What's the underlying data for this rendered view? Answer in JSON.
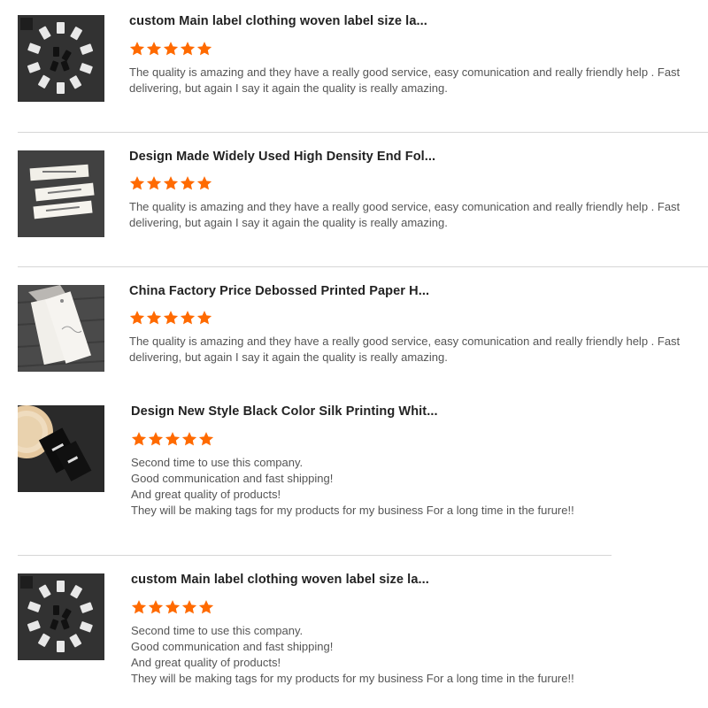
{
  "reviews": [
    {
      "title": "custom Main label clothing woven label size la...",
      "rating": 5,
      "text": "The quality is amazing and they have a really good service, easy comunication and really friendly help . Fast delivering, but again I say it again the quality is really amazing.",
      "thumbnail": "woven-labels-circle-photo"
    },
    {
      "title": "Design Made Widely Used High Density End Fol...",
      "rating": 5,
      "text": "The quality is amazing and they have a really good service, easy comunication and really friendly help . Fast delivering, but again I say it again the quality is really amazing.",
      "thumbnail": "folded-end-labels-photo"
    },
    {
      "title": "China Factory Price Debossed Printed Paper H...",
      "rating": 5,
      "text": "The quality is amazing and they have a really good service, easy comunication and really friendly help . Fast delivering, but again I say it again the quality is really amazing.",
      "thumbnail": "paper-hang-tags-photo"
    },
    {
      "title": "Design New Style Black Color Silk Printing Whit...",
      "rating": 5,
      "text": "Second time to use this company.\nGood communication and fast shipping!\nAnd great quality of products!\nThey will be making tags for my products for my business For a long time in the furure!!",
      "thumbnail": "black-printed-labels-photo"
    },
    {
      "title": "custom Main label clothing woven label size la...",
      "rating": 5,
      "text": "Second time to use this company.\nGood communication and fast shipping!\nAnd great quality of products!\nThey will be making tags for my products for my business For a long time in the furure!!",
      "thumbnail": "woven-labels-circle-photo"
    }
  ],
  "colors": {
    "star": "#ff6a00",
    "title": "#222222",
    "text": "#555555",
    "divider": "#d6d6d6"
  }
}
